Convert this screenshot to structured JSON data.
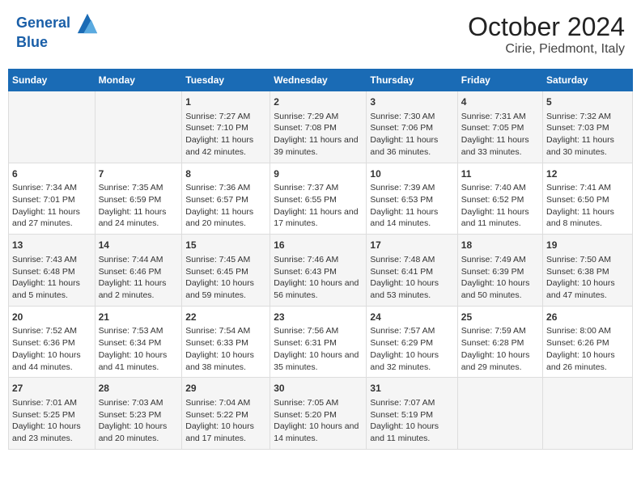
{
  "header": {
    "logo_line1": "General",
    "logo_line2": "Blue",
    "title": "October 2024",
    "subtitle": "Cirie, Piedmont, Italy"
  },
  "weekdays": [
    "Sunday",
    "Monday",
    "Tuesday",
    "Wednesday",
    "Thursday",
    "Friday",
    "Saturday"
  ],
  "rows": [
    [
      {
        "day": "",
        "sunrise": "",
        "sunset": "",
        "daylight": ""
      },
      {
        "day": "",
        "sunrise": "",
        "sunset": "",
        "daylight": ""
      },
      {
        "day": "1",
        "sunrise": "Sunrise: 7:27 AM",
        "sunset": "Sunset: 7:10 PM",
        "daylight": "Daylight: 11 hours and 42 minutes."
      },
      {
        "day": "2",
        "sunrise": "Sunrise: 7:29 AM",
        "sunset": "Sunset: 7:08 PM",
        "daylight": "Daylight: 11 hours and 39 minutes."
      },
      {
        "day": "3",
        "sunrise": "Sunrise: 7:30 AM",
        "sunset": "Sunset: 7:06 PM",
        "daylight": "Daylight: 11 hours and 36 minutes."
      },
      {
        "day": "4",
        "sunrise": "Sunrise: 7:31 AM",
        "sunset": "Sunset: 7:05 PM",
        "daylight": "Daylight: 11 hours and 33 minutes."
      },
      {
        "day": "5",
        "sunrise": "Sunrise: 7:32 AM",
        "sunset": "Sunset: 7:03 PM",
        "daylight": "Daylight: 11 hours and 30 minutes."
      }
    ],
    [
      {
        "day": "6",
        "sunrise": "Sunrise: 7:34 AM",
        "sunset": "Sunset: 7:01 PM",
        "daylight": "Daylight: 11 hours and 27 minutes."
      },
      {
        "day": "7",
        "sunrise": "Sunrise: 7:35 AM",
        "sunset": "Sunset: 6:59 PM",
        "daylight": "Daylight: 11 hours and 24 minutes."
      },
      {
        "day": "8",
        "sunrise": "Sunrise: 7:36 AM",
        "sunset": "Sunset: 6:57 PM",
        "daylight": "Daylight: 11 hours and 20 minutes."
      },
      {
        "day": "9",
        "sunrise": "Sunrise: 7:37 AM",
        "sunset": "Sunset: 6:55 PM",
        "daylight": "Daylight: 11 hours and 17 minutes."
      },
      {
        "day": "10",
        "sunrise": "Sunrise: 7:39 AM",
        "sunset": "Sunset: 6:53 PM",
        "daylight": "Daylight: 11 hours and 14 minutes."
      },
      {
        "day": "11",
        "sunrise": "Sunrise: 7:40 AM",
        "sunset": "Sunset: 6:52 PM",
        "daylight": "Daylight: 11 hours and 11 minutes."
      },
      {
        "day": "12",
        "sunrise": "Sunrise: 7:41 AM",
        "sunset": "Sunset: 6:50 PM",
        "daylight": "Daylight: 11 hours and 8 minutes."
      }
    ],
    [
      {
        "day": "13",
        "sunrise": "Sunrise: 7:43 AM",
        "sunset": "Sunset: 6:48 PM",
        "daylight": "Daylight: 11 hours and 5 minutes."
      },
      {
        "day": "14",
        "sunrise": "Sunrise: 7:44 AM",
        "sunset": "Sunset: 6:46 PM",
        "daylight": "Daylight: 11 hours and 2 minutes."
      },
      {
        "day": "15",
        "sunrise": "Sunrise: 7:45 AM",
        "sunset": "Sunset: 6:45 PM",
        "daylight": "Daylight: 10 hours and 59 minutes."
      },
      {
        "day": "16",
        "sunrise": "Sunrise: 7:46 AM",
        "sunset": "Sunset: 6:43 PM",
        "daylight": "Daylight: 10 hours and 56 minutes."
      },
      {
        "day": "17",
        "sunrise": "Sunrise: 7:48 AM",
        "sunset": "Sunset: 6:41 PM",
        "daylight": "Daylight: 10 hours and 53 minutes."
      },
      {
        "day": "18",
        "sunrise": "Sunrise: 7:49 AM",
        "sunset": "Sunset: 6:39 PM",
        "daylight": "Daylight: 10 hours and 50 minutes."
      },
      {
        "day": "19",
        "sunrise": "Sunrise: 7:50 AM",
        "sunset": "Sunset: 6:38 PM",
        "daylight": "Daylight: 10 hours and 47 minutes."
      }
    ],
    [
      {
        "day": "20",
        "sunrise": "Sunrise: 7:52 AM",
        "sunset": "Sunset: 6:36 PM",
        "daylight": "Daylight: 10 hours and 44 minutes."
      },
      {
        "day": "21",
        "sunrise": "Sunrise: 7:53 AM",
        "sunset": "Sunset: 6:34 PM",
        "daylight": "Daylight: 10 hours and 41 minutes."
      },
      {
        "day": "22",
        "sunrise": "Sunrise: 7:54 AM",
        "sunset": "Sunset: 6:33 PM",
        "daylight": "Daylight: 10 hours and 38 minutes."
      },
      {
        "day": "23",
        "sunrise": "Sunrise: 7:56 AM",
        "sunset": "Sunset: 6:31 PM",
        "daylight": "Daylight: 10 hours and 35 minutes."
      },
      {
        "day": "24",
        "sunrise": "Sunrise: 7:57 AM",
        "sunset": "Sunset: 6:29 PM",
        "daylight": "Daylight: 10 hours and 32 minutes."
      },
      {
        "day": "25",
        "sunrise": "Sunrise: 7:59 AM",
        "sunset": "Sunset: 6:28 PM",
        "daylight": "Daylight: 10 hours and 29 minutes."
      },
      {
        "day": "26",
        "sunrise": "Sunrise: 8:00 AM",
        "sunset": "Sunset: 6:26 PM",
        "daylight": "Daylight: 10 hours and 26 minutes."
      }
    ],
    [
      {
        "day": "27",
        "sunrise": "Sunrise: 7:01 AM",
        "sunset": "Sunset: 5:25 PM",
        "daylight": "Daylight: 10 hours and 23 minutes."
      },
      {
        "day": "28",
        "sunrise": "Sunrise: 7:03 AM",
        "sunset": "Sunset: 5:23 PM",
        "daylight": "Daylight: 10 hours and 20 minutes."
      },
      {
        "day": "29",
        "sunrise": "Sunrise: 7:04 AM",
        "sunset": "Sunset: 5:22 PM",
        "daylight": "Daylight: 10 hours and 17 minutes."
      },
      {
        "day": "30",
        "sunrise": "Sunrise: 7:05 AM",
        "sunset": "Sunset: 5:20 PM",
        "daylight": "Daylight: 10 hours and 14 minutes."
      },
      {
        "day": "31",
        "sunrise": "Sunrise: 7:07 AM",
        "sunset": "Sunset: 5:19 PM",
        "daylight": "Daylight: 10 hours and 11 minutes."
      },
      {
        "day": "",
        "sunrise": "",
        "sunset": "",
        "daylight": ""
      },
      {
        "day": "",
        "sunrise": "",
        "sunset": "",
        "daylight": ""
      }
    ]
  ]
}
